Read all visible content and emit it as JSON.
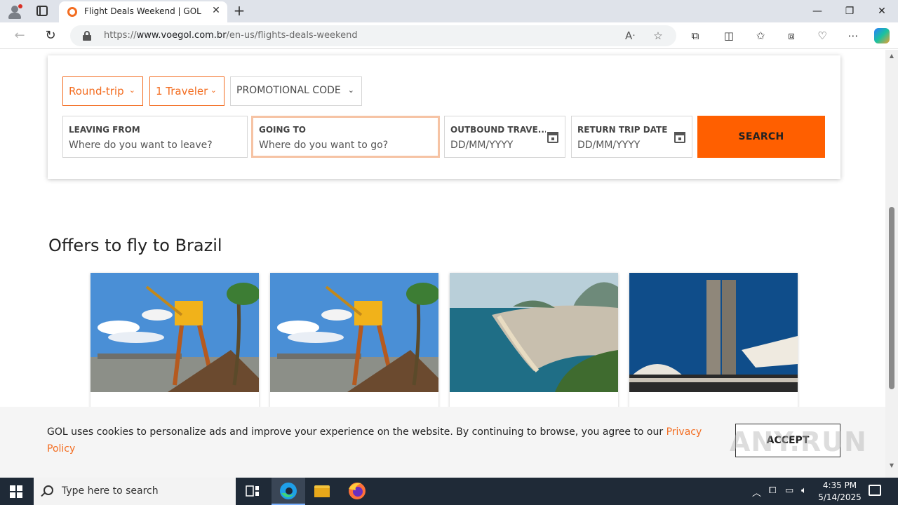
{
  "browser": {
    "tab_title": "Flight Deals Weekend | GOL Airlines",
    "tab_close": "✕",
    "new_tab": "+",
    "url_prefix": "https://",
    "url_domain": "www.voegol.com.br",
    "url_path": "/en-us/flights-deals-weekend",
    "window_minimize": "—",
    "window_restore": "❐",
    "window_close": "✕"
  },
  "search": {
    "trip_type": "Round-trip",
    "travelers": "1 Traveler",
    "promo": "PROMOTIONAL CODE",
    "from_label": "LEAVING FROM",
    "from_placeholder": "Where do you want to leave?",
    "to_label": "GOING TO",
    "to_placeholder": "Where do you want to go?",
    "outbound_label": "OUTBOUND TRAVE...",
    "outbound_placeholder": "DD/MM/YYYY",
    "return_label": "RETURN TRIP DATE",
    "return_placeholder": "DD/MM/YYYY",
    "search_button": "SEARCH"
  },
  "offers": {
    "title": "Offers to fly to Brazil"
  },
  "cookie": {
    "message": "GOL uses cookies to personalize ads and improve your experience on the website. By continuing to browse, you agree to our ",
    "link": "Privacy Policy",
    "accept": "ACCEPT"
  },
  "watermark": "ANY.RUN",
  "taskbar": {
    "search_placeholder": "Type here to search",
    "time": "4:35 PM",
    "date": "5/14/2025"
  },
  "colors": {
    "brand_orange": "#ff5f00",
    "brand_text_orange": "#f36d21"
  }
}
